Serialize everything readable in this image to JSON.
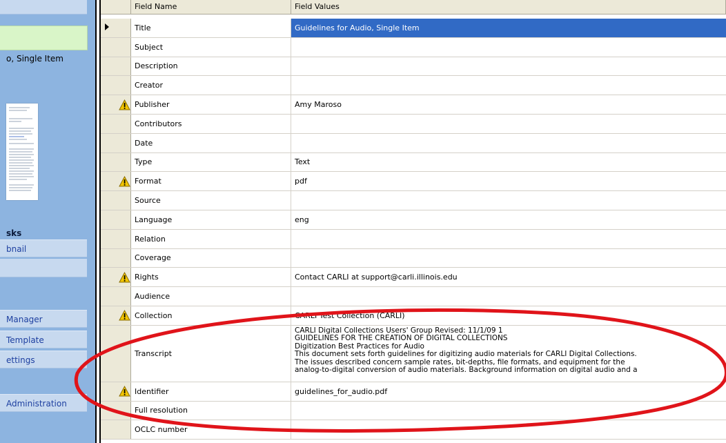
{
  "left_pane": {
    "item_title": "o, Single Item",
    "section_heading": "sks",
    "links": [
      "bnail",
      "Manager",
      " Template",
      "ettings",
      "Administration"
    ]
  },
  "grid": {
    "headers": {
      "name": "Field Name",
      "value": "Field Values"
    },
    "rows": [
      {
        "name": "Title",
        "value": "Guidelines for Audio, Single Item",
        "warn": false,
        "selected": true
      },
      {
        "name": "Subject",
        "value": "",
        "warn": false
      },
      {
        "name": "Description",
        "value": "",
        "warn": false
      },
      {
        "name": "Creator",
        "value": "",
        "warn": false
      },
      {
        "name": "Publisher",
        "value": "Amy Maroso",
        "warn": true
      },
      {
        "name": "Contributors",
        "value": "",
        "warn": false
      },
      {
        "name": "Date",
        "value": "",
        "warn": false
      },
      {
        "name": "Type",
        "value": "Text",
        "warn": false
      },
      {
        "name": "Format",
        "value": "pdf",
        "warn": true
      },
      {
        "name": "Source",
        "value": "",
        "warn": false
      },
      {
        "name": "Language",
        "value": "eng",
        "warn": false
      },
      {
        "name": "Relation",
        "value": "",
        "warn": false
      },
      {
        "name": "Coverage",
        "value": "",
        "warn": false
      },
      {
        "name": "Rights",
        "value": "Contact CARLI at support@carli.illinois.edu",
        "warn": true
      },
      {
        "name": "Audience",
        "value": "",
        "warn": false
      },
      {
        "name": "Collection",
        "value": "CARLI Test Collection (CARLI)",
        "warn": true
      },
      {
        "name": "Transcript",
        "warn": false,
        "lines": [
          "CARLI Digital Collections Users' Group Revised: 11/1/09 1",
          "GUIDELINES FOR THE CREATION OF DIGITAL COLLECTIONS",
          "Digitization Best Practices for Audio",
          "This document sets forth guidelines for digitizing audio materials for CARLI Digital Collections.",
          "The issues described concern sample rates, bit-depths, file formats, and equipment for the",
          "analog-to-digital conversion of audio materials. Background information on digital audio and a"
        ]
      },
      {
        "name": "Identifier",
        "value": "guidelines_for_audio.pdf",
        "warn": true
      },
      {
        "name": "Full resolution",
        "value": "",
        "warn": false
      },
      {
        "name": "OCLC number",
        "value": "",
        "warn": false
      }
    ]
  },
  "colors": {
    "selection": "#316ac5",
    "annotation": "#e0141a",
    "warning": "#f2c500"
  }
}
